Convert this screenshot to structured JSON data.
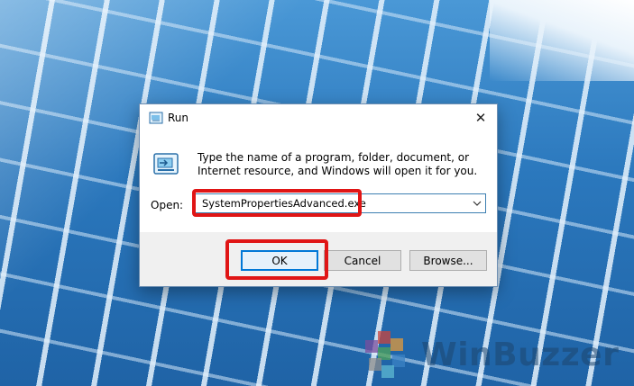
{
  "dialog": {
    "title": "Run",
    "description": "Type the name of a program, folder, document, or Internet resource, and Windows will open it for you.",
    "open_label": "Open:",
    "open_value": "SystemPropertiesAdvanced.exe",
    "buttons": {
      "ok": "OK",
      "cancel": "Cancel",
      "browse": "Browse..."
    },
    "close_icon": "close-icon"
  },
  "highlight_color": "#e01515",
  "watermark": {
    "text": "WinBuzzer"
  }
}
